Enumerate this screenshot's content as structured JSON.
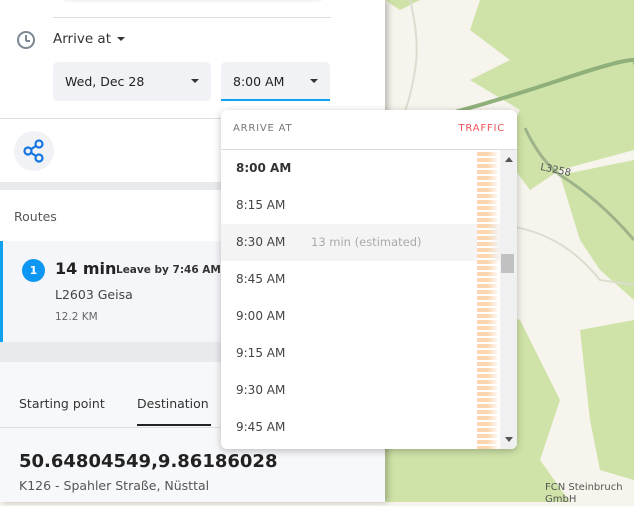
{
  "trip": {
    "mode_label": "Arrive at",
    "date": "Wed, Dec 28",
    "time": "8:00 AM"
  },
  "routes": {
    "heading": "Routes",
    "items": [
      {
        "number": "1",
        "duration": "14 min",
        "leave_by": "Leave by 7:46 AM",
        "road": "L2603 Geisa",
        "distance": "12.2 KM"
      }
    ]
  },
  "tabs": [
    {
      "label": "Starting point",
      "active": false
    },
    {
      "label": "Destination",
      "active": true
    }
  ],
  "destination": {
    "coords": "50.64804549,9.86186028",
    "address": "K126 - Spahler Straße, Nüsttal"
  },
  "dropdown": {
    "title": "ARRIVE AT",
    "traffic": "TRAFFIC",
    "selected": "8:00 AM",
    "options": [
      {
        "time": "8:00 AM",
        "note": ""
      },
      {
        "time": "8:15 AM",
        "note": ""
      },
      {
        "time": "8:30 AM",
        "note": "13 min (estimated)"
      },
      {
        "time": "8:45 AM",
        "note": ""
      },
      {
        "time": "9:00 AM",
        "note": ""
      },
      {
        "time": "9:15 AM",
        "note": ""
      },
      {
        "time": "9:30 AM",
        "note": ""
      },
      {
        "time": "9:45 AM",
        "note": ""
      }
    ]
  },
  "map": {
    "labels": {
      "road": "L3258",
      "poi": "FCN Steinbruch GmbH"
    }
  },
  "colors": {
    "accent": "#0d96f2",
    "traffic": "#f0545a",
    "forest": "#cfe3a8",
    "land": "#f6f4ec"
  }
}
